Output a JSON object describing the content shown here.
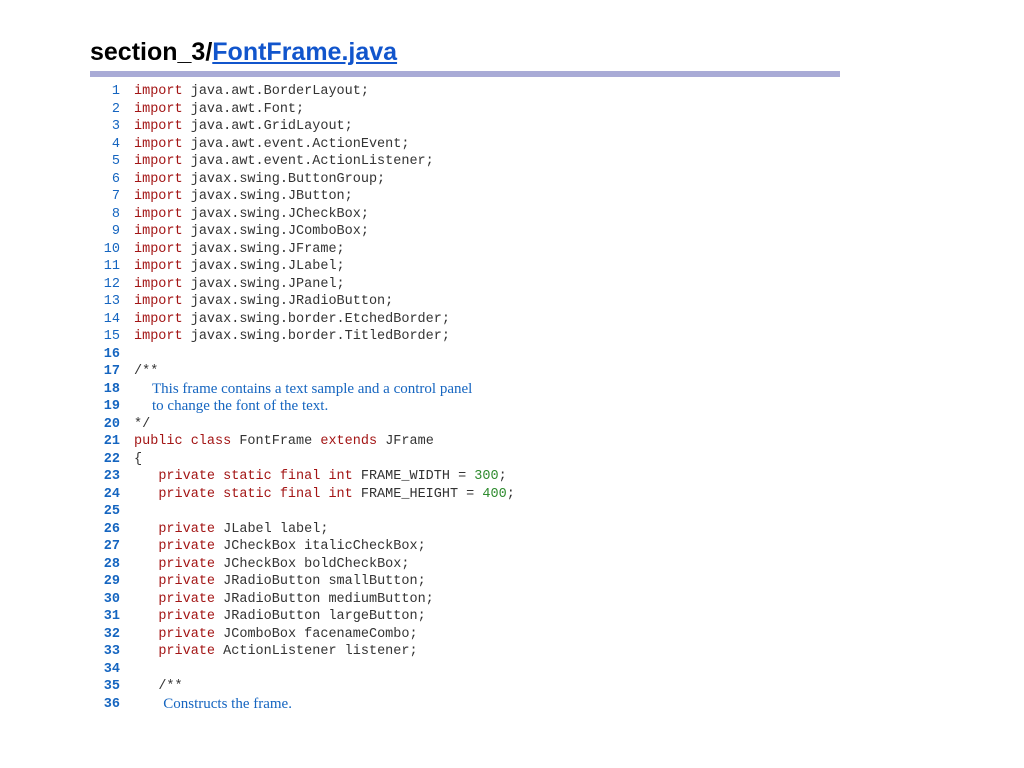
{
  "header": {
    "prefix": "section_3/",
    "link": "FontFrame.java"
  },
  "lines": [
    {
      "n": "1",
      "bold": false,
      "segments": [
        {
          "c": "kw",
          "t": "import"
        },
        {
          "c": "sp",
          "t": " "
        },
        {
          "c": "id",
          "t": "java.awt.BorderLayout;"
        }
      ]
    },
    {
      "n": "2",
      "bold": false,
      "segments": [
        {
          "c": "kw",
          "t": "import"
        },
        {
          "c": "sp",
          "t": " "
        },
        {
          "c": "id",
          "t": "java.awt.Font;"
        }
      ]
    },
    {
      "n": "3",
      "bold": false,
      "segments": [
        {
          "c": "kw",
          "t": "import"
        },
        {
          "c": "sp",
          "t": " "
        },
        {
          "c": "id",
          "t": "java.awt.GridLayout;"
        }
      ]
    },
    {
      "n": "4",
      "bold": false,
      "segments": [
        {
          "c": "kw",
          "t": "import"
        },
        {
          "c": "sp",
          "t": " "
        },
        {
          "c": "id",
          "t": "java.awt.event.ActionEvent;"
        }
      ]
    },
    {
      "n": "5",
      "bold": false,
      "segments": [
        {
          "c": "kw",
          "t": "import"
        },
        {
          "c": "sp",
          "t": " "
        },
        {
          "c": "id",
          "t": "java.awt.event.ActionListener;"
        }
      ]
    },
    {
      "n": "6",
      "bold": false,
      "segments": [
        {
          "c": "kw",
          "t": "import"
        },
        {
          "c": "sp",
          "t": " "
        },
        {
          "c": "id",
          "t": "javax.swing.ButtonGroup;"
        }
      ]
    },
    {
      "n": "7",
      "bold": false,
      "segments": [
        {
          "c": "kw",
          "t": "import"
        },
        {
          "c": "sp",
          "t": " "
        },
        {
          "c": "id",
          "t": "javax.swing.JButton;"
        }
      ]
    },
    {
      "n": "8",
      "bold": false,
      "segments": [
        {
          "c": "kw",
          "t": "import"
        },
        {
          "c": "sp",
          "t": " "
        },
        {
          "c": "id",
          "t": "javax.swing.JCheckBox;"
        }
      ]
    },
    {
      "n": "9",
      "bold": false,
      "segments": [
        {
          "c": "kw",
          "t": "import"
        },
        {
          "c": "sp",
          "t": " "
        },
        {
          "c": "id",
          "t": "javax.swing.JComboBox;"
        }
      ]
    },
    {
      "n": "10",
      "bold": false,
      "segments": [
        {
          "c": "kw",
          "t": "import"
        },
        {
          "c": "sp",
          "t": " "
        },
        {
          "c": "id",
          "t": "javax.swing.JFrame;"
        }
      ]
    },
    {
      "n": "11",
      "bold": false,
      "segments": [
        {
          "c": "kw",
          "t": "import"
        },
        {
          "c": "sp",
          "t": " "
        },
        {
          "c": "id",
          "t": "javax.swing.JLabel;"
        }
      ]
    },
    {
      "n": "12",
      "bold": false,
      "segments": [
        {
          "c": "kw",
          "t": "import"
        },
        {
          "c": "sp",
          "t": " "
        },
        {
          "c": "id",
          "t": "javax.swing.JPanel;"
        }
      ]
    },
    {
      "n": "13",
      "bold": false,
      "segments": [
        {
          "c": "kw",
          "t": "import"
        },
        {
          "c": "sp",
          "t": " "
        },
        {
          "c": "id",
          "t": "javax.swing.JRadioButton;"
        }
      ]
    },
    {
      "n": "14",
      "bold": false,
      "segments": [
        {
          "c": "kw",
          "t": "import"
        },
        {
          "c": "sp",
          "t": " "
        },
        {
          "c": "id",
          "t": "javax.swing.border.EtchedBorder;"
        }
      ]
    },
    {
      "n": "15",
      "bold": false,
      "segments": [
        {
          "c": "kw",
          "t": "import"
        },
        {
          "c": "sp",
          "t": " "
        },
        {
          "c": "id",
          "t": "javax.swing.border.TitledBorder;"
        }
      ]
    },
    {
      "n": "16",
      "bold": true,
      "segments": []
    },
    {
      "n": "17",
      "bold": true,
      "segments": [
        {
          "c": "cmt",
          "t": "/**"
        }
      ]
    },
    {
      "n": "18",
      "bold": true,
      "doc": "This frame contains a text sample and a control panel"
    },
    {
      "n": "19",
      "bold": true,
      "doc": "to change the font of the text."
    },
    {
      "n": "20",
      "bold": true,
      "segments": [
        {
          "c": "cmt",
          "t": "*/"
        }
      ]
    },
    {
      "n": "21",
      "bold": true,
      "segments": [
        {
          "c": "kw",
          "t": "public class"
        },
        {
          "c": "sp",
          "t": " "
        },
        {
          "c": "id",
          "t": "FontFrame"
        },
        {
          "c": "sp",
          "t": " "
        },
        {
          "c": "kw",
          "t": "extends"
        },
        {
          "c": "sp",
          "t": " "
        },
        {
          "c": "id",
          "t": "JFrame"
        }
      ]
    },
    {
      "n": "22",
      "bold": true,
      "segments": [
        {
          "c": "id",
          "t": "{"
        }
      ]
    },
    {
      "n": "23",
      "bold": true,
      "segments": [
        {
          "c": "sp",
          "t": "   "
        },
        {
          "c": "kw",
          "t": "private static final int"
        },
        {
          "c": "sp",
          "t": " "
        },
        {
          "c": "id",
          "t": "FRAME_WIDTH = "
        },
        {
          "c": "num",
          "t": "300"
        },
        {
          "c": "id",
          "t": ";"
        }
      ]
    },
    {
      "n": "24",
      "bold": true,
      "segments": [
        {
          "c": "sp",
          "t": "   "
        },
        {
          "c": "kw",
          "t": "private static final int"
        },
        {
          "c": "sp",
          "t": " "
        },
        {
          "c": "id",
          "t": "FRAME_HEIGHT = "
        },
        {
          "c": "num",
          "t": "400"
        },
        {
          "c": "id",
          "t": ";"
        }
      ]
    },
    {
      "n": "25",
      "bold": true,
      "segments": []
    },
    {
      "n": "26",
      "bold": true,
      "segments": [
        {
          "c": "sp",
          "t": "   "
        },
        {
          "c": "kw",
          "t": "private"
        },
        {
          "c": "sp",
          "t": " "
        },
        {
          "c": "id",
          "t": "JLabel label;"
        }
      ]
    },
    {
      "n": "27",
      "bold": true,
      "segments": [
        {
          "c": "sp",
          "t": "   "
        },
        {
          "c": "kw",
          "t": "private"
        },
        {
          "c": "sp",
          "t": " "
        },
        {
          "c": "id",
          "t": "JCheckBox italicCheckBox;"
        }
      ]
    },
    {
      "n": "28",
      "bold": true,
      "segments": [
        {
          "c": "sp",
          "t": "   "
        },
        {
          "c": "kw",
          "t": "private"
        },
        {
          "c": "sp",
          "t": " "
        },
        {
          "c": "id",
          "t": "JCheckBox boldCheckBox;"
        }
      ]
    },
    {
      "n": "29",
      "bold": true,
      "segments": [
        {
          "c": "sp",
          "t": "   "
        },
        {
          "c": "kw",
          "t": "private"
        },
        {
          "c": "sp",
          "t": " "
        },
        {
          "c": "id",
          "t": "JRadioButton smallButton;"
        }
      ]
    },
    {
      "n": "30",
      "bold": true,
      "segments": [
        {
          "c": "sp",
          "t": "   "
        },
        {
          "c": "kw",
          "t": "private"
        },
        {
          "c": "sp",
          "t": " "
        },
        {
          "c": "id",
          "t": "JRadioButton mediumButton;"
        }
      ]
    },
    {
      "n": "31",
      "bold": true,
      "segments": [
        {
          "c": "sp",
          "t": "   "
        },
        {
          "c": "kw",
          "t": "private"
        },
        {
          "c": "sp",
          "t": " "
        },
        {
          "c": "id",
          "t": "JRadioButton largeButton;"
        }
      ]
    },
    {
      "n": "32",
      "bold": true,
      "segments": [
        {
          "c": "sp",
          "t": "   "
        },
        {
          "c": "kw",
          "t": "private"
        },
        {
          "c": "sp",
          "t": " "
        },
        {
          "c": "id",
          "t": "JComboBox facenameCombo;"
        }
      ]
    },
    {
      "n": "33",
      "bold": true,
      "segments": [
        {
          "c": "sp",
          "t": "   "
        },
        {
          "c": "kw",
          "t": "private"
        },
        {
          "c": "sp",
          "t": " "
        },
        {
          "c": "id",
          "t": "ActionListener listener;"
        }
      ]
    },
    {
      "n": "34",
      "bold": true,
      "segments": []
    },
    {
      "n": "35",
      "bold": true,
      "segments": [
        {
          "c": "sp",
          "t": "   "
        },
        {
          "c": "cmt",
          "t": "/**"
        }
      ]
    },
    {
      "n": "36",
      "bold": true,
      "doc": "   Constructs the frame."
    }
  ]
}
